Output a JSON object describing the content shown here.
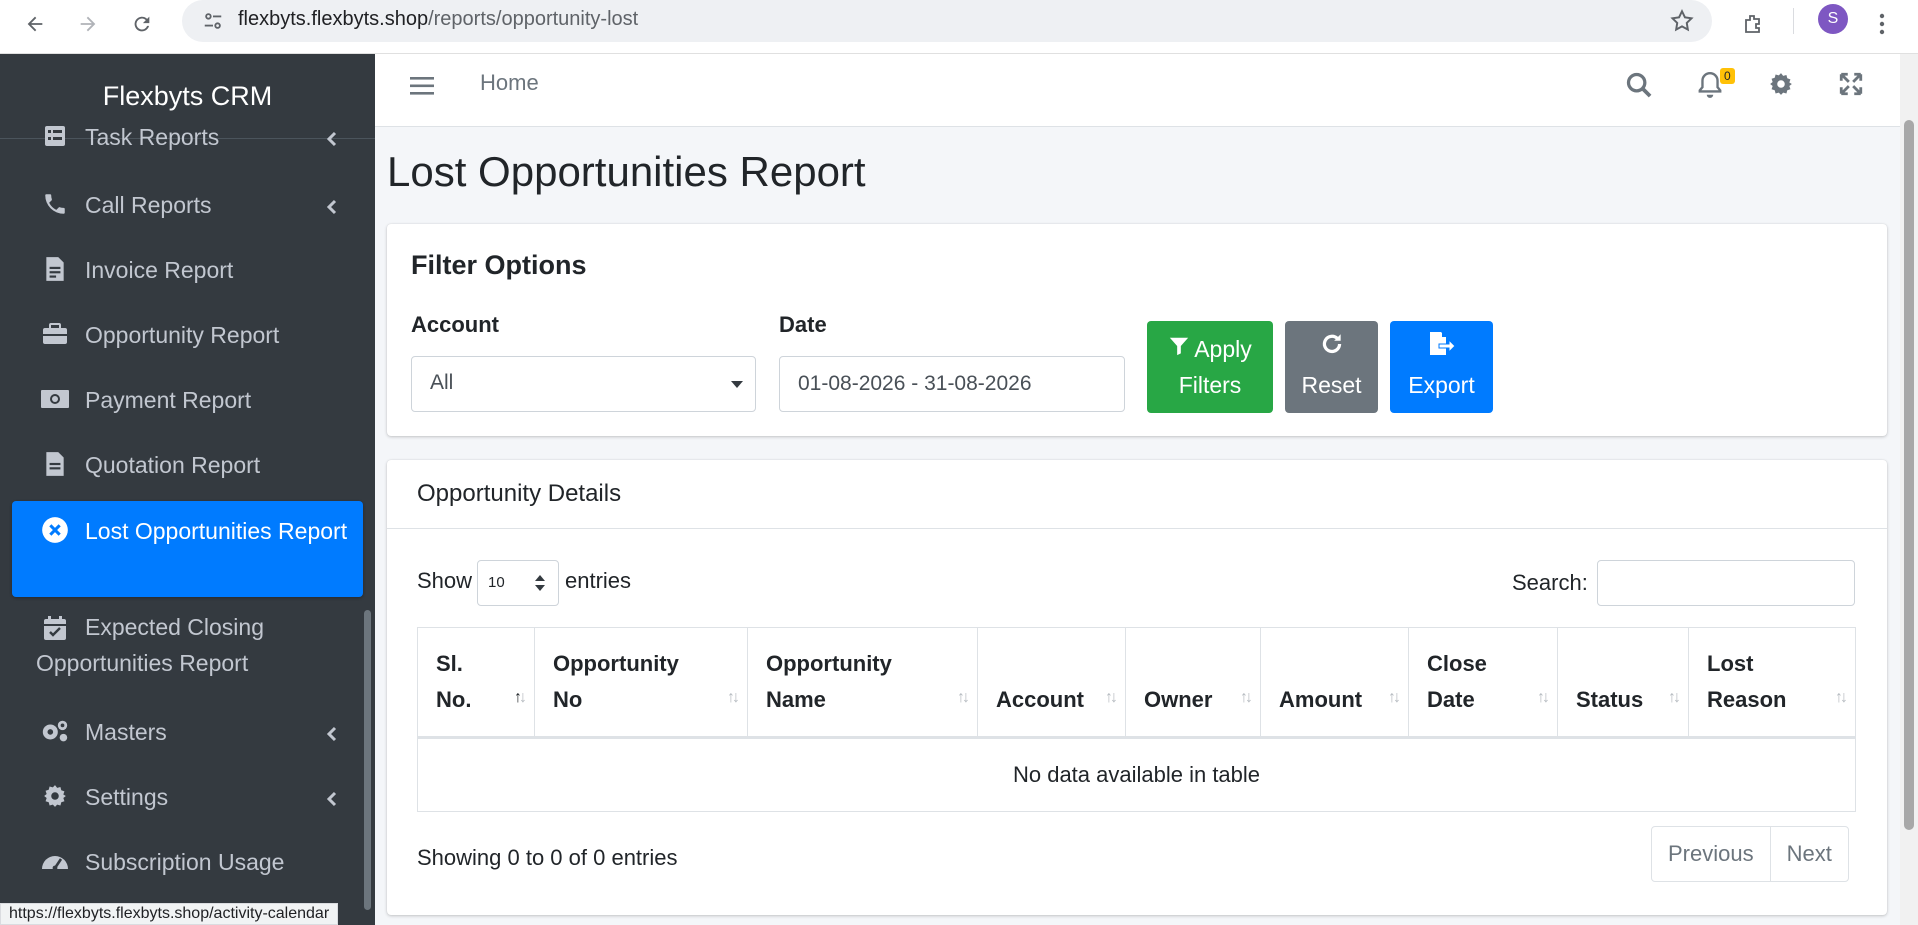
{
  "browser": {
    "url_host": "flexbyts.flexbyts.shop",
    "url_path": "/reports/opportunity-lost",
    "profile_initial": "S",
    "status_url": "https://flexbyts.flexbyts.shop/activity-calendar"
  },
  "sidebar": {
    "brand": "Flexbyts CRM",
    "items": [
      {
        "label": "Task Reports",
        "icon": "tasks-icon",
        "has_submenu": true
      },
      {
        "label": "Call Reports",
        "icon": "phone-icon",
        "has_submenu": true
      },
      {
        "label": "Invoice Report",
        "icon": "file-invoice-icon",
        "has_submenu": false
      },
      {
        "label": "Opportunity Report",
        "icon": "briefcase-icon",
        "has_submenu": false
      },
      {
        "label": "Payment Report",
        "icon": "money-bill-icon",
        "has_submenu": false
      },
      {
        "label": "Quotation Report",
        "icon": "file-icon",
        "has_submenu": false
      },
      {
        "label": "Lost Opportunities Report",
        "icon": "times-circle-icon",
        "active": true
      },
      {
        "label": "Expected Closing Opportunities Report",
        "icon": "calendar-check-icon"
      },
      {
        "label": "Masters",
        "icon": "cogs-icon",
        "has_submenu": true
      },
      {
        "label": "Settings",
        "icon": "cog-icon",
        "has_submenu": true
      },
      {
        "label": "Subscription Usage",
        "icon": "tachometer-icon",
        "has_submenu": false
      }
    ]
  },
  "topnav": {
    "home": "Home",
    "notifications_count": "0"
  },
  "page": {
    "title": "Lost Opportunities Report"
  },
  "filters": {
    "title": "Filter Options",
    "account_label": "Account",
    "account_value": "All",
    "date_label": "Date",
    "date_value": "01-08-2026 - 31-08-2026",
    "apply_line1": "Apply",
    "apply_line2": "Filters",
    "reset": "Reset",
    "export": "Export"
  },
  "details": {
    "title": "Opportunity Details",
    "show": "Show",
    "page_length": "10",
    "entries": "entries",
    "search_label": "Search:",
    "columns": [
      {
        "l1": "Sl.",
        "l2": "No."
      },
      {
        "l1": "Opportunity",
        "l2": "No"
      },
      {
        "l1": "Opportunity",
        "l2": "Name"
      },
      {
        "l1": "",
        "l2": "Account"
      },
      {
        "l1": "",
        "l2": "Owner"
      },
      {
        "l1": "",
        "l2": "Amount"
      },
      {
        "l1": "Close",
        "l2": "Date"
      },
      {
        "l1": "",
        "l2": "Status"
      },
      {
        "l1": "Lost",
        "l2": "Reason"
      }
    ],
    "empty": "No data available in table",
    "info": "Showing 0 to 0 of 0 entries",
    "previous": "Previous",
    "next": "Next"
  },
  "colors": {
    "sidebar_bg": "#343a40",
    "active": "#007bff",
    "apply": "#28a745",
    "reset": "#6c757d",
    "export": "#007bff",
    "badge": "#ffc107"
  }
}
